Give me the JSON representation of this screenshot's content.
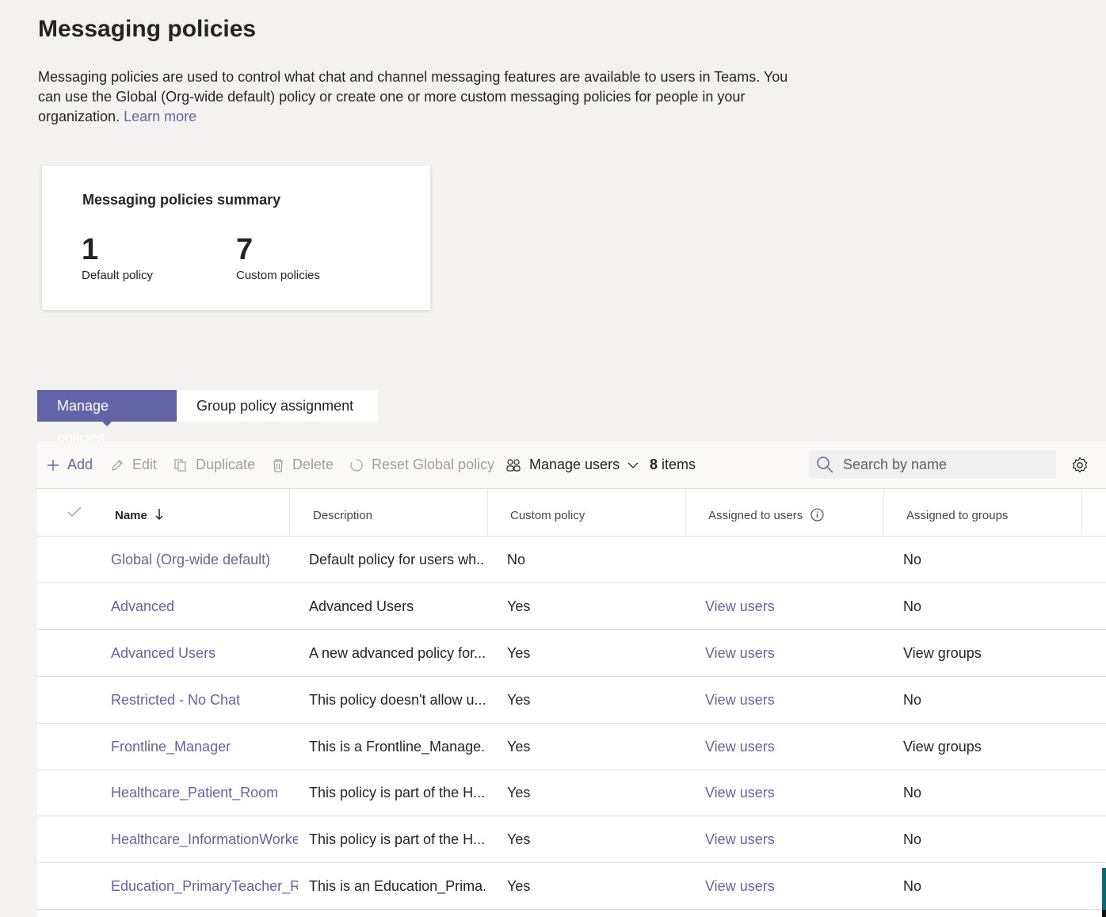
{
  "header": {
    "title": "Messaging policies",
    "description": "Messaging policies are used to control what chat and channel messaging features are available to users in Teams. You can use the Global (Org-wide default) policy or create one or more custom messaging policies for people in your organization.",
    "learn_more": "Learn more"
  },
  "summary": {
    "title": "Messaging policies summary",
    "default_count": "1",
    "default_label": "Default policy",
    "custom_count": "7",
    "custom_label": "Custom policies"
  },
  "tabs": [
    {
      "label": "Manage policies",
      "active": true
    },
    {
      "label": "Group policy assignment",
      "active": false
    }
  ],
  "toolbar": {
    "add": "Add",
    "edit": "Edit",
    "duplicate": "Duplicate",
    "delete": "Delete",
    "reset": "Reset Global policy",
    "manage_users": "Manage users",
    "items_count": "8",
    "items_label": "items",
    "search_placeholder": "Search by name"
  },
  "table": {
    "columns": [
      "Name",
      "Description",
      "Custom policy",
      "Assigned to users",
      "Assigned to groups"
    ],
    "rows": [
      {
        "name": "Global (Org-wide default)",
        "description": "Default policy for users wh...",
        "custom": "No",
        "users": "",
        "groups": "No"
      },
      {
        "name": "Advanced",
        "description": "Advanced Users",
        "custom": "Yes",
        "users": "View users",
        "groups": "No"
      },
      {
        "name": "Advanced Users",
        "description": "A new advanced policy for...",
        "custom": "Yes",
        "users": "View users",
        "groups": "View groups"
      },
      {
        "name": "Restricted - No Chat",
        "description": "This policy doesn't allow u...",
        "custom": "Yes",
        "users": "View users",
        "groups": "No"
      },
      {
        "name": "Frontline_Manager",
        "description": "This is a Frontline_Manage...",
        "custom": "Yes",
        "users": "View users",
        "groups": "View groups"
      },
      {
        "name": "Healthcare_Patient_Room",
        "description": "This policy is part of the H...",
        "custom": "Yes",
        "users": "View users",
        "groups": "No"
      },
      {
        "name": "Healthcare_InformationWorker",
        "description": "This policy is part of the H...",
        "custom": "Yes",
        "users": "View users",
        "groups": "No"
      },
      {
        "name": "Education_PrimaryTeacher_RemoteLearning",
        "description": "This is an Education_Prima...",
        "custom": "Yes",
        "users": "View users",
        "groups": "No"
      }
    ]
  },
  "colors": {
    "brand": "#6264a7",
    "text": "#252423",
    "disabled": "#a19f9d",
    "background": "#f3f2f1"
  }
}
